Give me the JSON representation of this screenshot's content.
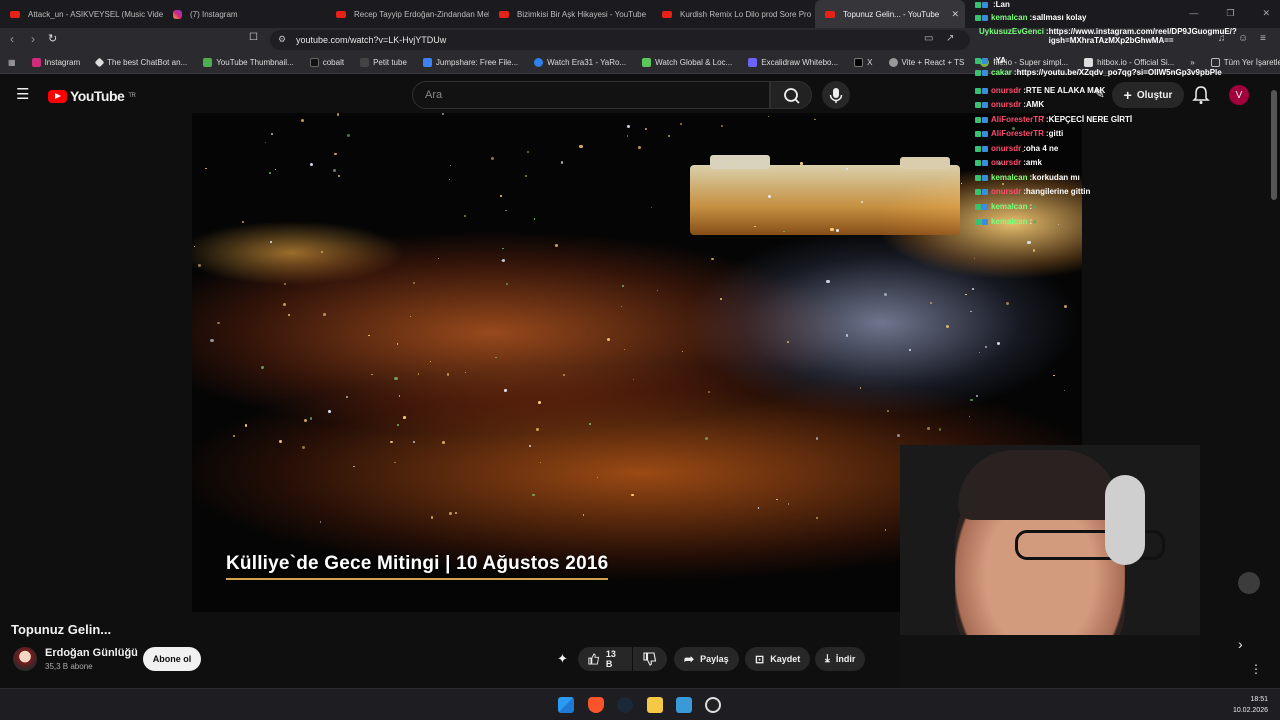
{
  "browser": {
    "tabs": [
      {
        "label": "Attack_un - ASIKVEYSEL (Music Video)",
        "icon": "youtube"
      },
      {
        "label": "(7) Instagram",
        "icon": "instagram"
      },
      {
        "label": "Recep Tayyip Erdoğan-Zindandan Mek",
        "icon": "youtube"
      },
      {
        "label": "Bizimkisi Bir Aşk Hikayesi - YouTube",
        "icon": "youtube"
      },
      {
        "label": "Kurdish Remix Lo Dilo prod Sore Pro",
        "icon": "youtube"
      },
      {
        "label": "Topunuz Gelin... - YouTube",
        "icon": "youtube",
        "active": true
      }
    ],
    "url": "youtube.com/watch?v=LK-HvjYTDUw",
    "bookmarks": [
      {
        "label": "Instagram",
        "color": "#d02a7a"
      },
      {
        "label": "The best ChatBot an...",
        "color": "#dddddd"
      },
      {
        "label": "YouTube Thumbnail...",
        "color": "#4caf50"
      },
      {
        "label": "cobalt",
        "color": "#222222"
      },
      {
        "label": "Petit tube",
        "color": "#444444"
      },
      {
        "label": "Jumpshare: Free File...",
        "color": "#3b82f6"
      },
      {
        "label": "Watch Era31 - YaRo...",
        "color": "#2f80ed"
      },
      {
        "label": "Watch Global & Loc...",
        "color": "#5ac85a"
      },
      {
        "label": "Excalidraw Whitebo...",
        "color": "#6c63ff"
      },
      {
        "label": "X",
        "color": "#000000"
      },
      {
        "label": "Vite + React + TS",
        "color": "#999999"
      },
      {
        "label": "file.io - Super simpl...",
        "color": "#7cb342"
      },
      {
        "label": "hitbox.io - Official Si...",
        "color": "#dddddd"
      }
    ],
    "bookmarks_overflow": "»",
    "all_bookmarks": "Tüm Yer İşaretleri"
  },
  "youtube": {
    "logo_text": "YouTube",
    "region": "TR",
    "search_placeholder": "Ara",
    "create_label": "Oluştur",
    "avatar_letter": "V"
  },
  "video": {
    "caption": "Külliye`de Gece Mitingi | 10 Ağustos 2016",
    "title": "Topunuz Gelin...",
    "channel": "Erdoğan Günlüğü",
    "subscribers": "35,3 B abone",
    "subscribe_label": "Abone ol",
    "likes": "13 B",
    "share_label": "Paylaş",
    "save_label": "Kaydet",
    "download_label": "İndir"
  },
  "chat": [
    {
      "user": "",
      "msg": "Lan",
      "user_color": "#ff6b6b"
    },
    {
      "user": "kemalcan",
      "msg": "sallması kolay",
      "user_color": "#7cff7c"
    },
    {
      "user": "UykusuzEvGenci",
      "msg": "https://www.instagram.com/reel/DP9JGuogmuE/?igsh=MXhraTAzMXp2bGhwMA==",
      "user_color": "#7cff7c"
    },
    {
      "user": "",
      "msg": "YA",
      "user_color": "#ff6b6b"
    },
    {
      "user": "cakar",
      "msg": "https://youtu.be/XZqdv_po7qg?si=OllW5nGp3v9pbPle",
      "user_color": "#7cff7c"
    },
    {
      "user": "onursdr",
      "msg": "RTE NE ALAKA MAK",
      "user_color": "#ff4d6d"
    },
    {
      "user": "onursdr",
      "msg": "AMK",
      "user_color": "#ff4d6d"
    },
    {
      "user": "AliForesterTR",
      "msg": "KEPÇECİ NERE GİRTİ",
      "user_color": "#ff4d6d"
    },
    {
      "user": "AliForesterTR",
      "msg": "gitti",
      "user_color": "#ff4d6d"
    },
    {
      "user": "onursdr",
      "msg": "oha 4 ne",
      "user_color": "#ff4d6d"
    },
    {
      "user": "onursdr",
      "msg": "amk",
      "user_color": "#ff4d6d"
    },
    {
      "user": "kemalcan",
      "msg": "korkudan mı",
      "user_color": "#7cff7c"
    },
    {
      "user": "onursdr",
      "msg": "hangilerine gittin",
      "user_color": "#ff4d6d"
    },
    {
      "user": "kemalcan",
      "msg": "",
      "user_color": "#7cff7c"
    },
    {
      "user": "kemalcan",
      "msg": "",
      "user_color": "#7cff7c"
    }
  ],
  "taskbar": {
    "time": "18:51",
    "date": "10.02.2026"
  }
}
